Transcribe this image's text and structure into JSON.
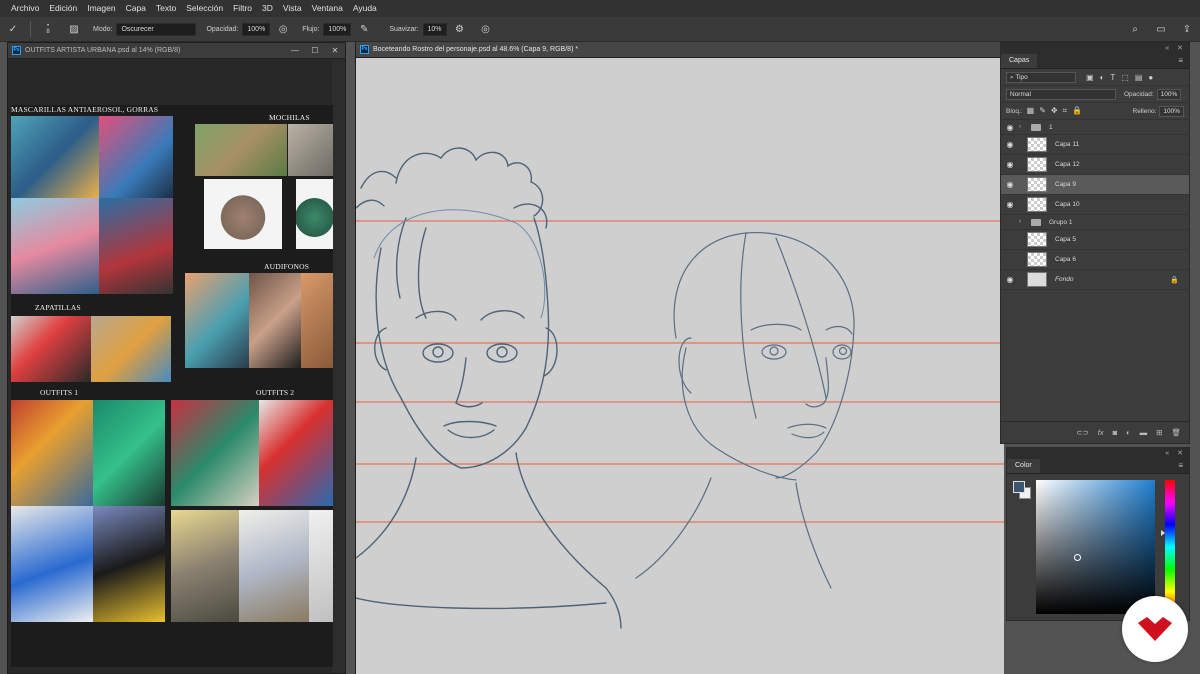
{
  "menu": [
    "Archivo",
    "Edición",
    "Imagen",
    "Capa",
    "Texto",
    "Selección",
    "Filtro",
    "3D",
    "Vista",
    "Ventana",
    "Ayuda"
  ],
  "options": {
    "brush_size": "8",
    "mode_label": "Modo:",
    "mode_value": "Oscurecer",
    "opacity_label": "Opacidad:",
    "opacity_value": "100%",
    "flow_label": "Flujo:",
    "flow_value": "100%",
    "smooth_label": "Suavizar:",
    "smooth_value": "10%"
  },
  "left_doc": {
    "title": "OUTFITS ARTISTA URBANA.psd al 14% (RGB/8)",
    "labels": {
      "masks": "MASCARILLAS  ANTIAEROSOL, GORRAS",
      "backpacks": "MOCHILAS",
      "headphones": "AUDIFONOS",
      "sneakers": "ZAPATILLAS",
      "outfits1": "OUTFITS 1",
      "outfits2": "OUTFITS 2"
    }
  },
  "main_doc": {
    "title": "Boceteando Rostro del personaje.psd al 48.6% (Capa 9, RGB/8) *"
  },
  "layers_panel": {
    "tab": "Capas",
    "filter": "Tipo",
    "blend": "Normal",
    "opacity_label": "Opacidad:",
    "opacity_value": "100%",
    "lock_label": "Bloq.:",
    "fill_label": "Relleno:",
    "fill_value": "100%",
    "layers": [
      {
        "name": "1",
        "type": "group",
        "visible": true
      },
      {
        "name": "Capa 11",
        "type": "layer",
        "visible": true
      },
      {
        "name": "Capa 12",
        "type": "layer",
        "visible": true
      },
      {
        "name": "Capa 9",
        "type": "layer",
        "visible": true,
        "selected": true
      },
      {
        "name": "Capa 10",
        "type": "layer",
        "visible": true
      },
      {
        "name": "Grupo 1",
        "type": "group",
        "visible": false
      },
      {
        "name": "Capa 5",
        "type": "layer",
        "visible": false
      },
      {
        "name": "Capa 6",
        "type": "layer",
        "visible": false
      },
      {
        "name": "Fondo",
        "type": "background",
        "visible": true
      }
    ]
  },
  "color_panel": {
    "tab": "Color",
    "foreground": "#3b566e",
    "background": "#f2f2f2"
  },
  "colors": {
    "guide_line": "#e0735a",
    "sketch": "#5a6e84",
    "brand": "#d0101e"
  }
}
